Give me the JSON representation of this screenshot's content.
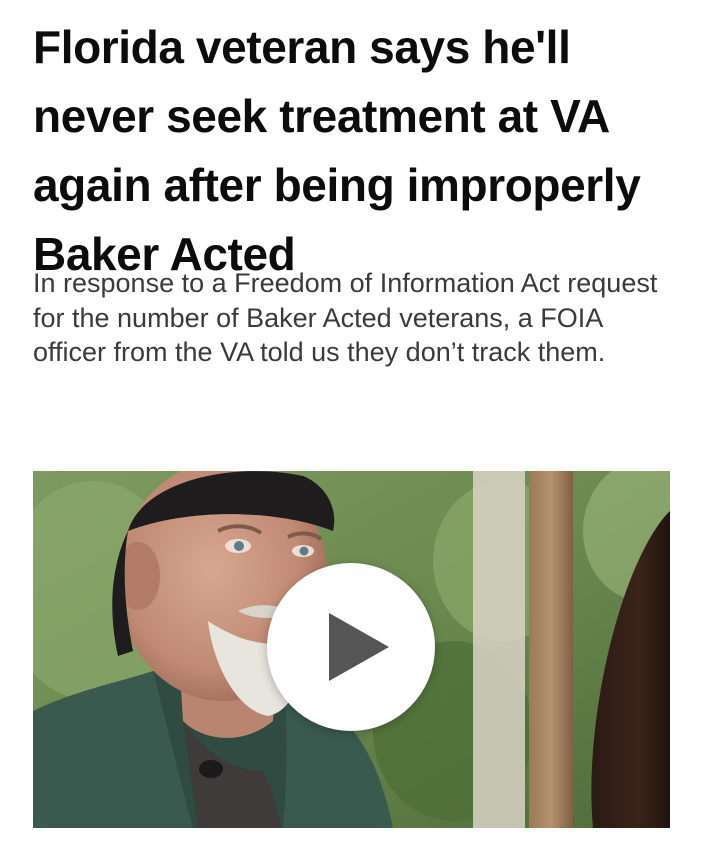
{
  "article": {
    "headline": "Florida veteran says he'll never seek treatment at VA again after being improperly Baker Acted",
    "dek": "In response to a Freedom of Information Act request for the number of Baker Acted veterans, a FOIA officer from the VA told us they don’t track them."
  },
  "video": {
    "play_icon": "play-icon",
    "play_button_color": "#ffffff",
    "play_icon_color": "#555555"
  },
  "colors": {
    "headline": "#0c0c0c",
    "dek": "#3a3a3a",
    "background": "#ffffff"
  }
}
